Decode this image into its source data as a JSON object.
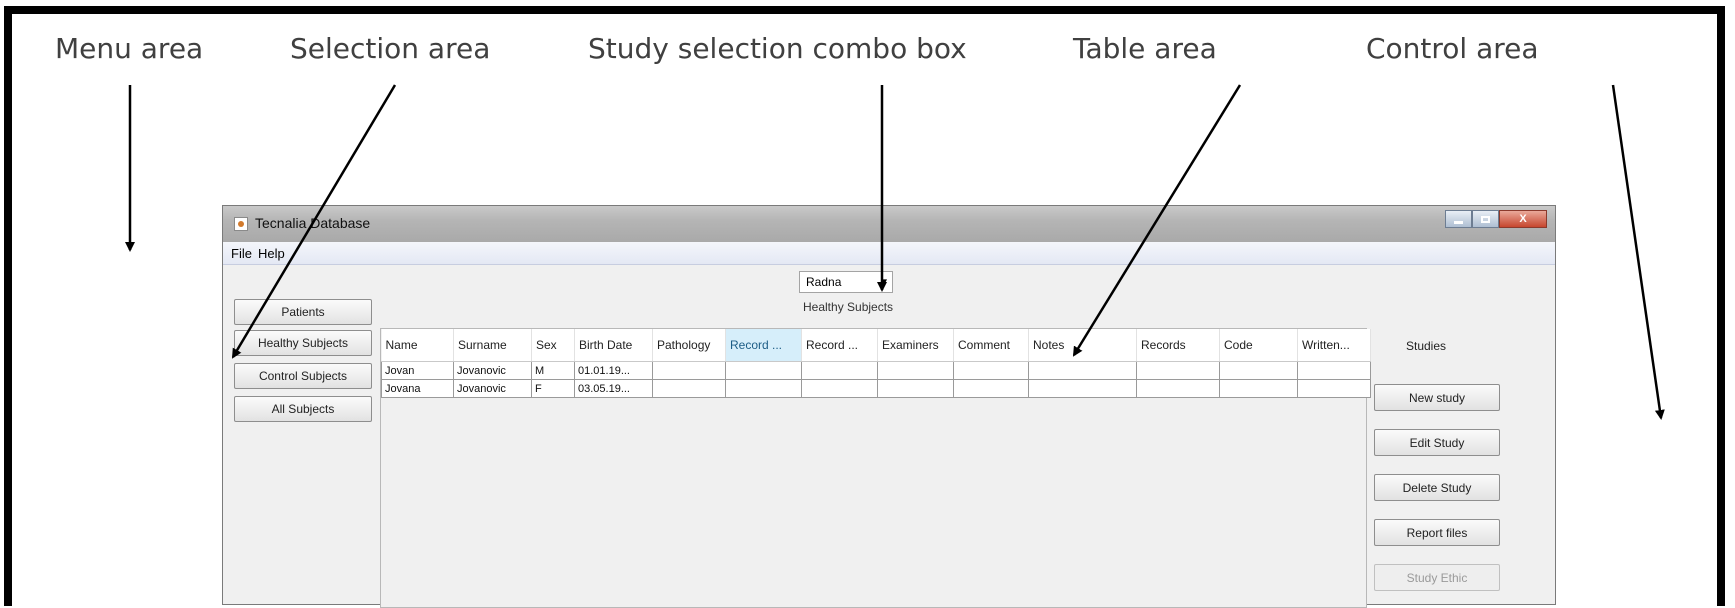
{
  "annotations": {
    "menu_area": "Menu area",
    "selection_area": "Selection area",
    "study_selection_combo_box": "Study selection combo box",
    "table_area": "Table area",
    "control_area": "Control area"
  },
  "window": {
    "title": "Tecnalia Database",
    "menu": [
      "File",
      "Help"
    ],
    "controls": {
      "close": "X"
    }
  },
  "study_combo": {
    "selected": "Radna",
    "chevron": "▾"
  },
  "current_selection_label": "Healthy Subjects",
  "selection_buttons": [
    "Patients",
    "Healthy Subjects",
    "Control Subjects",
    "All Subjects"
  ],
  "table": {
    "columns": [
      "Name",
      "Surname",
      "Sex",
      "Birth Date",
      "Pathology",
      "Record ...",
      "Record ...",
      "Examiners",
      "Comment",
      "Notes",
      "Records",
      "Code",
      "Written..."
    ],
    "selected_column_index": 5,
    "rows": [
      [
        "Jovan",
        "Jovanovic",
        "M",
        "01.01.19...",
        "",
        "",
        "",
        "",
        "",
        "",
        "",
        "",
        ""
      ],
      [
        "Jovana",
        "Jovanovic",
        "F",
        "03.05.19...",
        "",
        "",
        "",
        "",
        "",
        "",
        "",
        "",
        ""
      ]
    ]
  },
  "control": {
    "studies_label": "Studies",
    "buttons": [
      "New study",
      "Edit Study",
      "Delete Study",
      "Report files",
      "Study Ethic"
    ]
  },
  "colors": {
    "annotation_text": "#404040",
    "selected_column_bg": "#d6eefa",
    "close_button": "#c7462e"
  }
}
